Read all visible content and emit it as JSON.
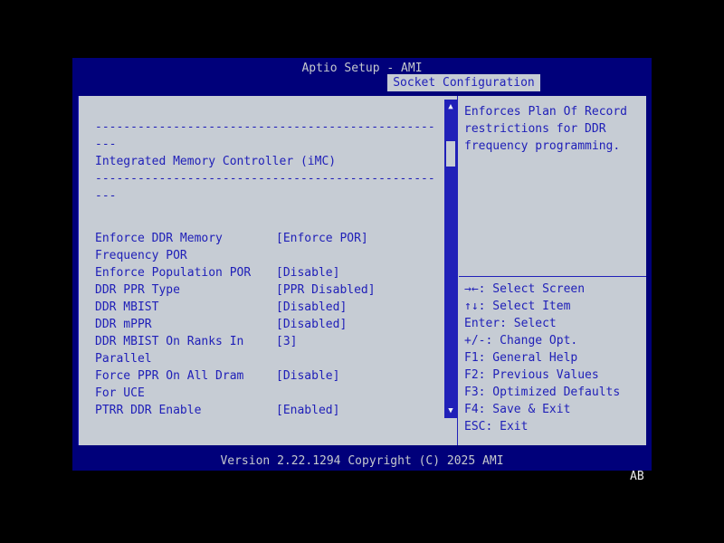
{
  "window": {
    "title": "Aptio Setup - AMI",
    "tab": "Socket Configuration",
    "version_line": "Version 2.22.1294 Copyright (C) 2025 AMI",
    "corner_label": "AB"
  },
  "colors": {
    "navy_bg": "#00007a",
    "panel_bg": "#c6ccd4",
    "text_blue": "#2020b8",
    "header_text": "#c5c9cd"
  },
  "main": {
    "separator_long": "------------------------------------------------",
    "separator_short": "---",
    "section_title": "Integrated Memory Controller (iMC)",
    "items": [
      {
        "label1": "Enforce DDR Memory",
        "label2": "Frequency POR",
        "value": "[Enforce POR]"
      },
      {
        "label1": "Enforce Population POR",
        "label2": "",
        "value": "[Disable]"
      },
      {
        "label1": "DDR PPR Type",
        "label2": "",
        "value": "[PPR Disabled]"
      },
      {
        "label1": "DDR MBIST",
        "label2": "",
        "value": "[Disabled]"
      },
      {
        "label1": "DDR mPPR",
        "label2": "",
        "value": "[Disabled]"
      },
      {
        "label1": "DDR MBIST On Ranks In",
        "label2": "Parallel",
        "value": "[3]"
      },
      {
        "label1": "Force PPR On All Dram",
        "label2": "For UCE",
        "value": "[Disable]"
      },
      {
        "label1": "PTRR DDR Enable",
        "label2": "",
        "value": "[Enabled]"
      }
    ]
  },
  "help": {
    "lines": [
      "Enforces Plan Of Record",
      "restrictions for DDR",
      "frequency programming."
    ],
    "keys": [
      "→←: Select Screen",
      "↑↓: Select Item",
      "Enter: Select",
      "+/-: Change Opt.",
      "F1: General Help",
      "F2: Previous Values",
      "F3: Optimized Defaults",
      "F4: Save & Exit",
      "ESC: Exit"
    ]
  },
  "scrollbar": {
    "up_icon": "▲",
    "down_icon": "▼"
  }
}
